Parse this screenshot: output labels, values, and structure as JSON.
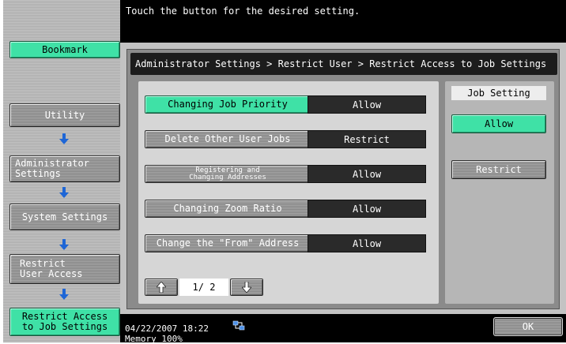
{
  "header": {
    "message": "Touch the button for the desired setting."
  },
  "sidebar": {
    "bookmark_label": "Bookmark",
    "items": [
      {
        "label": "Utility"
      },
      {
        "label": "Administrator\nSettings"
      },
      {
        "label": "System Settings"
      },
      {
        "label": "Restrict\nUser Access"
      },
      {
        "label": "Restrict Access\nto Job Settings"
      }
    ]
  },
  "breadcrumb": "Administrator Settings > Restrict User > Restrict Access to Job Settings",
  "settings": {
    "rows": [
      {
        "label": "Changing Job Priority",
        "value": "Allow"
      },
      {
        "label": "Delete Other User Jobs",
        "value": "Restrict"
      },
      {
        "label": "Registering and\nChanging Addresses",
        "value": "Allow"
      },
      {
        "label": "Changing Zoom Ratio",
        "value": "Allow"
      },
      {
        "label": "Change the \"From\" Address",
        "value": "Allow"
      }
    ],
    "page_indicator": "1/ 2"
  },
  "job_setting": {
    "title": "Job Setting",
    "allow_label": "Allow",
    "restrict_label": "Restrict"
  },
  "status": {
    "datetime": "04/22/2007   18:22",
    "memory": "Memory      100%",
    "ok_label": "OK"
  },
  "colors": {
    "accent_green": "#3fe1a6",
    "panel_gray": "#c3c3c3",
    "value_box": "#2a2a2a"
  }
}
